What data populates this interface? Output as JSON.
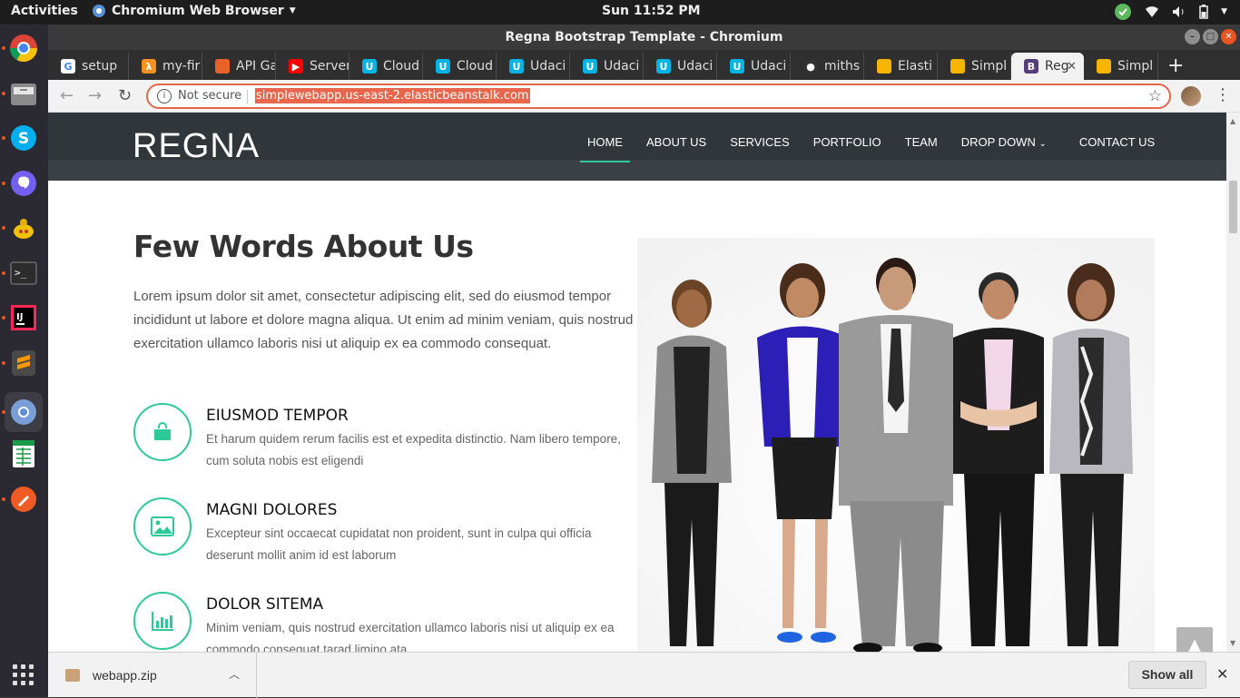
{
  "os": {
    "activities": "Activities",
    "app_name": "Chromium Web Browser",
    "clock": "Sun 11:52 PM"
  },
  "window": {
    "title": "Regna Bootstrap Template - Chromium"
  },
  "tabs": [
    {
      "label": "setup",
      "icon": "google-icon",
      "color": "#ffffff"
    },
    {
      "label": "my-fir",
      "icon": "aws-lambda-icon",
      "color": "#f7901e"
    },
    {
      "label": "API Ga",
      "icon": "aws-box-icon",
      "color": "#e8622a"
    },
    {
      "label": "Server",
      "icon": "youtube-icon",
      "color": "#ff0000"
    },
    {
      "label": "Cloud",
      "icon": "udacity-icon",
      "color": "#02b3e4"
    },
    {
      "label": "Cloud",
      "icon": "udacity-icon",
      "color": "#02b3e4"
    },
    {
      "label": "Udaci",
      "icon": "udacity-icon",
      "color": "#02b3e4"
    },
    {
      "label": "Udaci",
      "icon": "udacity-icon",
      "color": "#02b3e4"
    },
    {
      "label": "Udaci",
      "icon": "udacity-icon",
      "color": "#02b3e4"
    },
    {
      "label": "Udaci",
      "icon": "udacity-icon",
      "color": "#02b3e4"
    },
    {
      "label": "miths",
      "icon": "github-icon",
      "color": "#333333"
    },
    {
      "label": "Elasti",
      "icon": "aws-box-icon",
      "color": "#f7b500"
    },
    {
      "label": "Simpl",
      "icon": "aws-box-icon",
      "color": "#f7b500"
    },
    {
      "label": "Reg",
      "icon": "bootstrap-icon",
      "color": "#563d7c",
      "active": true
    },
    {
      "label": "Simpl",
      "icon": "aws-box-icon",
      "color": "#f7b500"
    }
  ],
  "address": {
    "security": "Not secure",
    "url": "simplewebapp.us-east-2.elasticbeanstalk.com"
  },
  "site": {
    "logo": "REGNA",
    "nav": [
      "HOME",
      "ABOUT US",
      "SERVICES",
      "PORTFOLIO",
      "TEAM",
      "DROP DOWN",
      "CONTACT US"
    ],
    "nav_active": "HOME",
    "accent": "#2dc997",
    "about": {
      "title": "Few Words About Us",
      "lead": "Lorem ipsum dolor sit amet, consectetur adipiscing elit, sed do eiusmod tempor incididunt ut labore et dolore magna aliqua. Ut enim ad minim veniam, quis nostrud exercitation ullamco laboris nisi ut aliquip ex ea commodo consequat.",
      "features": [
        {
          "title": "EIUSMOD TEMPOR",
          "text": "Et harum quidem rerum facilis est et expedita distinctio. Nam libero tempore, cum soluta nobis est eligendi",
          "icon": "shopping-bag-icon"
        },
        {
          "title": "MAGNI DOLORES",
          "text": "Excepteur sint occaecat cupidatat non proident, sunt in culpa qui officia deserunt mollit anim id est laborum",
          "icon": "image-icon"
        },
        {
          "title": "DOLOR SITEMA",
          "text": "Minim veniam, quis nostrud exercitation ullamco laboris nisi ut aliquip ex ea commodo consequat tarad limino ata",
          "icon": "bar-chart-icon"
        }
      ]
    }
  },
  "downloads": {
    "file": "webapp.zip",
    "show_all": "Show all"
  }
}
